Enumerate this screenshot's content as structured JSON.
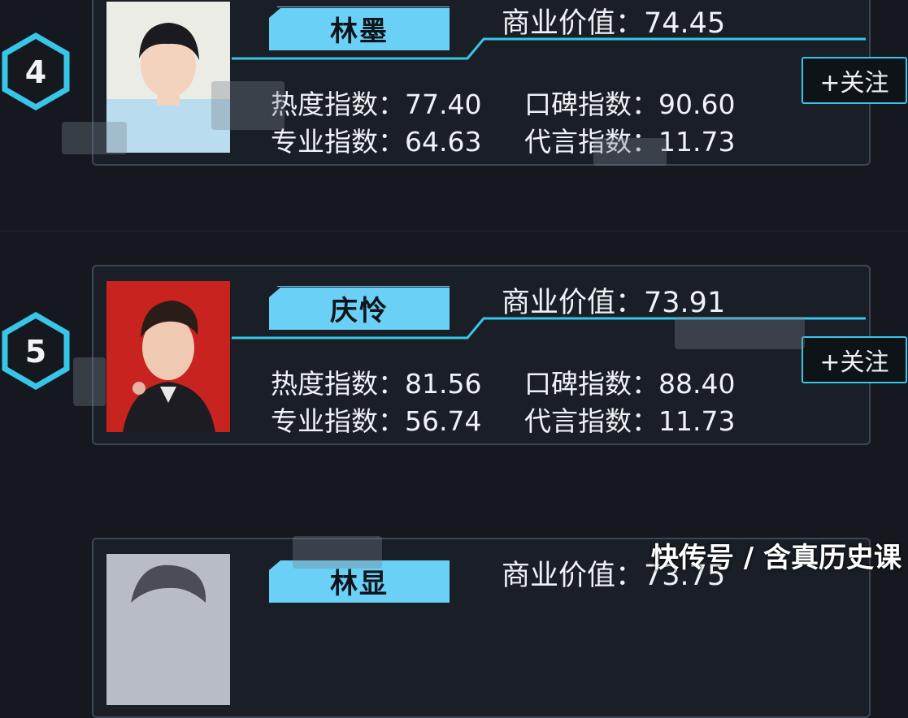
{
  "cards": [
    {
      "rank": "4",
      "name": "林墨",
      "business_label": "商业价值：",
      "business_value": "74.45",
      "heat_label": "热度指数：",
      "heat_value": "77.40",
      "reputation_label": "口碑指数：",
      "reputation_value": "90.60",
      "professional_label": "专业指数：",
      "professional_value": "64.63",
      "endorsement_label": "代言指数：",
      "endorsement_value": "11.73",
      "follow_label": "+关注"
    },
    {
      "rank": "5",
      "name": "庆怜",
      "business_label": "商业价值：",
      "business_value": "73.91",
      "heat_label": "热度指数：",
      "heat_value": "81.56",
      "reputation_label": "口碑指数：",
      "reputation_value": "88.40",
      "professional_label": "专业指数：",
      "professional_value": "56.74",
      "endorsement_label": "代言指数：",
      "endorsement_value": "11.73",
      "follow_label": "+关注"
    },
    {
      "name": "林显",
      "business_label": "商业价值：",
      "business_value": "73.75"
    }
  ],
  "watermark": "快传号 / 含真历史课",
  "colors": {
    "background": "#15191f",
    "accent": "#38c6e8",
    "name_tab": "#6ad0f5"
  }
}
